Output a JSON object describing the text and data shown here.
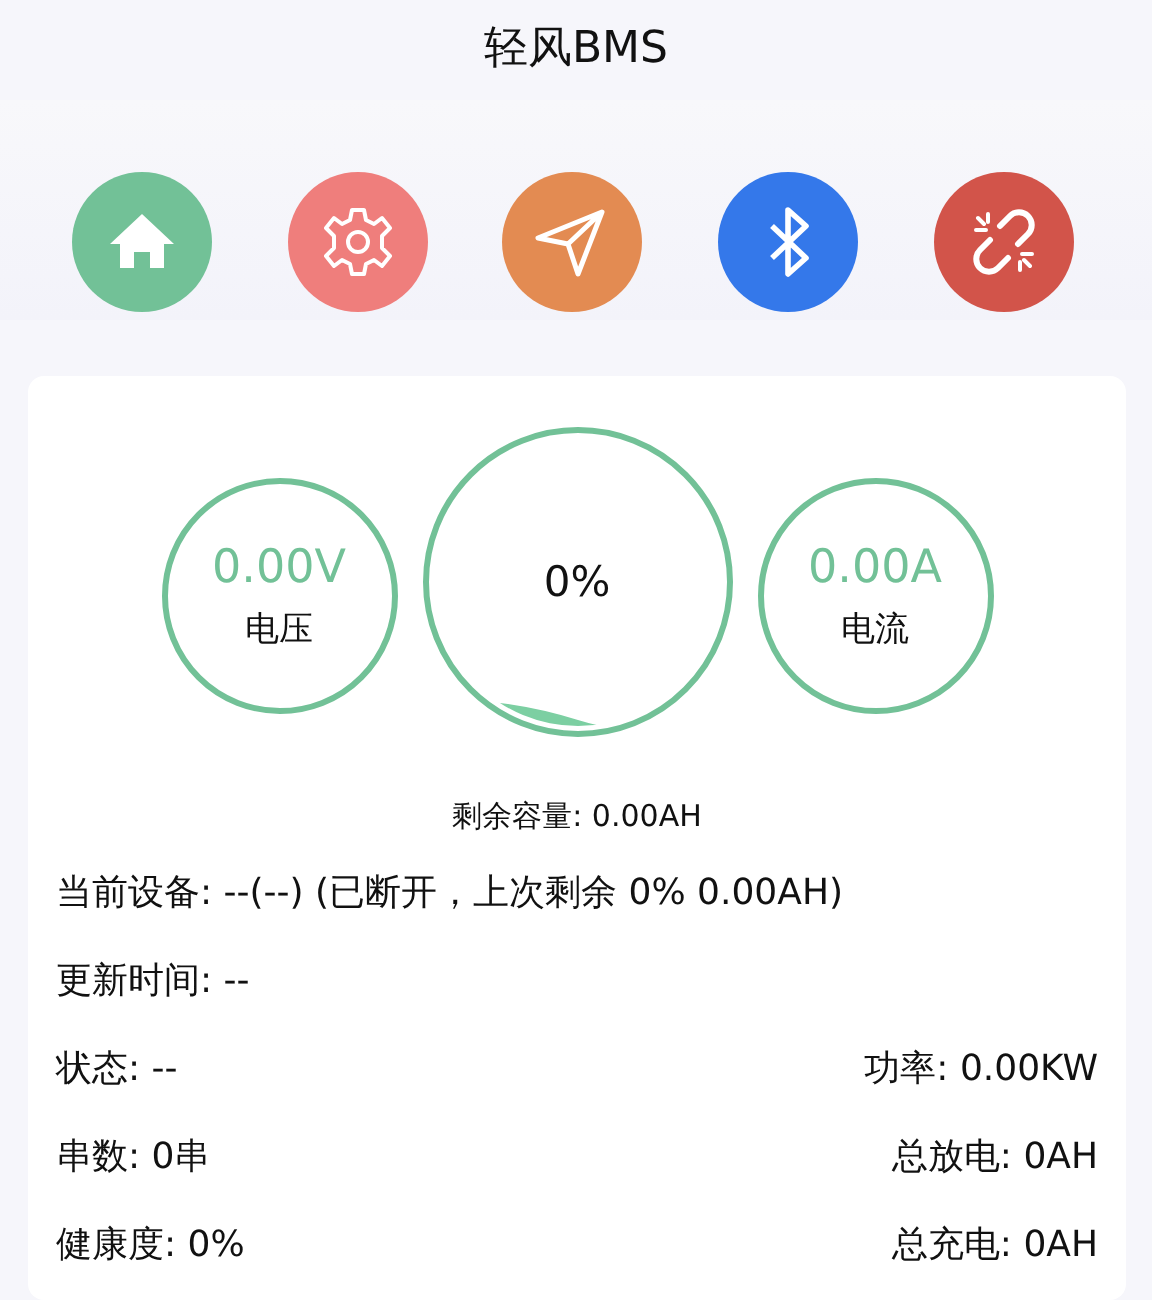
{
  "title": "轻风BMS",
  "toolbar": [
    {
      "kind": "home",
      "color": "#72c197"
    },
    {
      "kind": "settings",
      "color": "#ef7e7c"
    },
    {
      "kind": "send",
      "color": "#e38b52"
    },
    {
      "kind": "bluetooth",
      "color": "#3478ea"
    },
    {
      "kind": "unlink",
      "color": "#d2544a"
    }
  ],
  "gauges": {
    "voltage": {
      "value": "0.00V",
      "label": "电压"
    },
    "soc": {
      "value": "0%"
    },
    "current": {
      "value": "0.00A",
      "label": "电流"
    }
  },
  "remaining": "剩余容量: 0.00AH",
  "info_rows": [
    {
      "left": "当前设备: --(--) (已断开，上次剩余 0% 0.00AH)"
    },
    {
      "left": "更新时间: --"
    },
    {
      "left": "状态: --",
      "right": "功率: 0.00KW"
    },
    {
      "left": "串数: 0串",
      "right": "总放电: 0AH"
    },
    {
      "left": "健康度: 0%",
      "right": "总充电: 0AH"
    }
  ]
}
